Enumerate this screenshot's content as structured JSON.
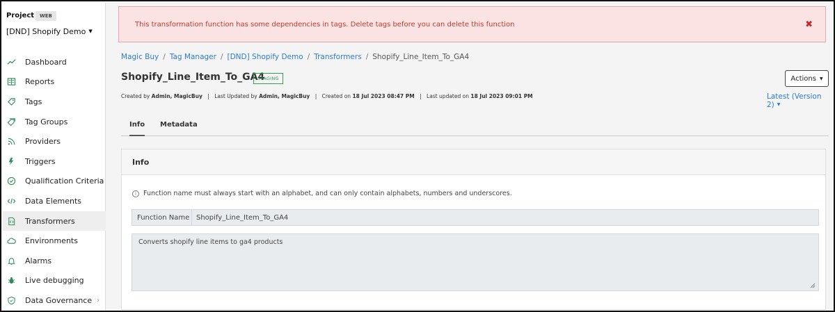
{
  "sidebar": {
    "project_label": "Project",
    "project_badge": "WEB",
    "project_name": "[DND] Shopify Demo",
    "items": [
      {
        "label": "Dashboard",
        "icon": "trend-line-icon"
      },
      {
        "label": "Reports",
        "icon": "book-icon"
      },
      {
        "label": "Tags",
        "icon": "tag-icon"
      },
      {
        "label": "Tag Groups",
        "icon": "tag-group-icon"
      },
      {
        "label": "Providers",
        "icon": "rss-icon"
      },
      {
        "label": "Triggers",
        "icon": "lightning-icon"
      },
      {
        "label": "Qualification Criteria",
        "icon": "check-circle-icon"
      },
      {
        "label": "Data Elements",
        "icon": "code-icon"
      },
      {
        "label": "Transformers",
        "icon": "code-file-icon",
        "active": true
      },
      {
        "label": "Environments",
        "icon": "cloud-icon"
      },
      {
        "label": "Alarms",
        "icon": "bell-icon"
      },
      {
        "label": "Live debugging",
        "icon": "bug-icon"
      },
      {
        "label": "Data Governance",
        "icon": "shield-icon"
      }
    ]
  },
  "alert": {
    "message": "This transformation function has some dependencies in tags. Delete tags before you can delete this function",
    "close_glyph": "✖"
  },
  "breadcrumb": {
    "items": [
      "Magic Buy",
      "Tag Manager",
      "[DND] Shopify Demo",
      "Transformers"
    ],
    "current": "Shopify_Line_Item_To_GA4",
    "separator": "/"
  },
  "page": {
    "title": "Shopify_Line_Item_To_GA4",
    "status": "STAGING",
    "actions_label": "Actions",
    "version_label": "Latest (Version 2)"
  },
  "meta": {
    "created_by_label": "Created by",
    "created_by": "Admin, MagicBuy",
    "updated_by_label": "Last Updated by",
    "updated_by": "Admin, MagicBuy",
    "created_on_label": "Created on",
    "created_on": "18 Jul 2023 08:47 PM",
    "updated_on_label": "Last updated on",
    "updated_on": "18 Jul 2023 09:01 PM"
  },
  "tabs": [
    {
      "label": "Info",
      "active": true
    },
    {
      "label": "Metadata",
      "active": false
    }
  ],
  "info_card": {
    "header": "Info",
    "hint": "Function name must always start with an alphabet, and can only contain alphabets, numbers and underscores.",
    "function_name_label": "Function Name",
    "function_name_value": "Shopify_Line_Item_To_GA4",
    "description_value": "Converts shopify line items to ga4 products"
  },
  "colors": {
    "accent_green": "#2e8b57",
    "link_blue": "#2b7bd4",
    "alert_bg": "#fbe3e4",
    "alert_text": "#c0392b",
    "staging_green": "#2e9e5b"
  }
}
